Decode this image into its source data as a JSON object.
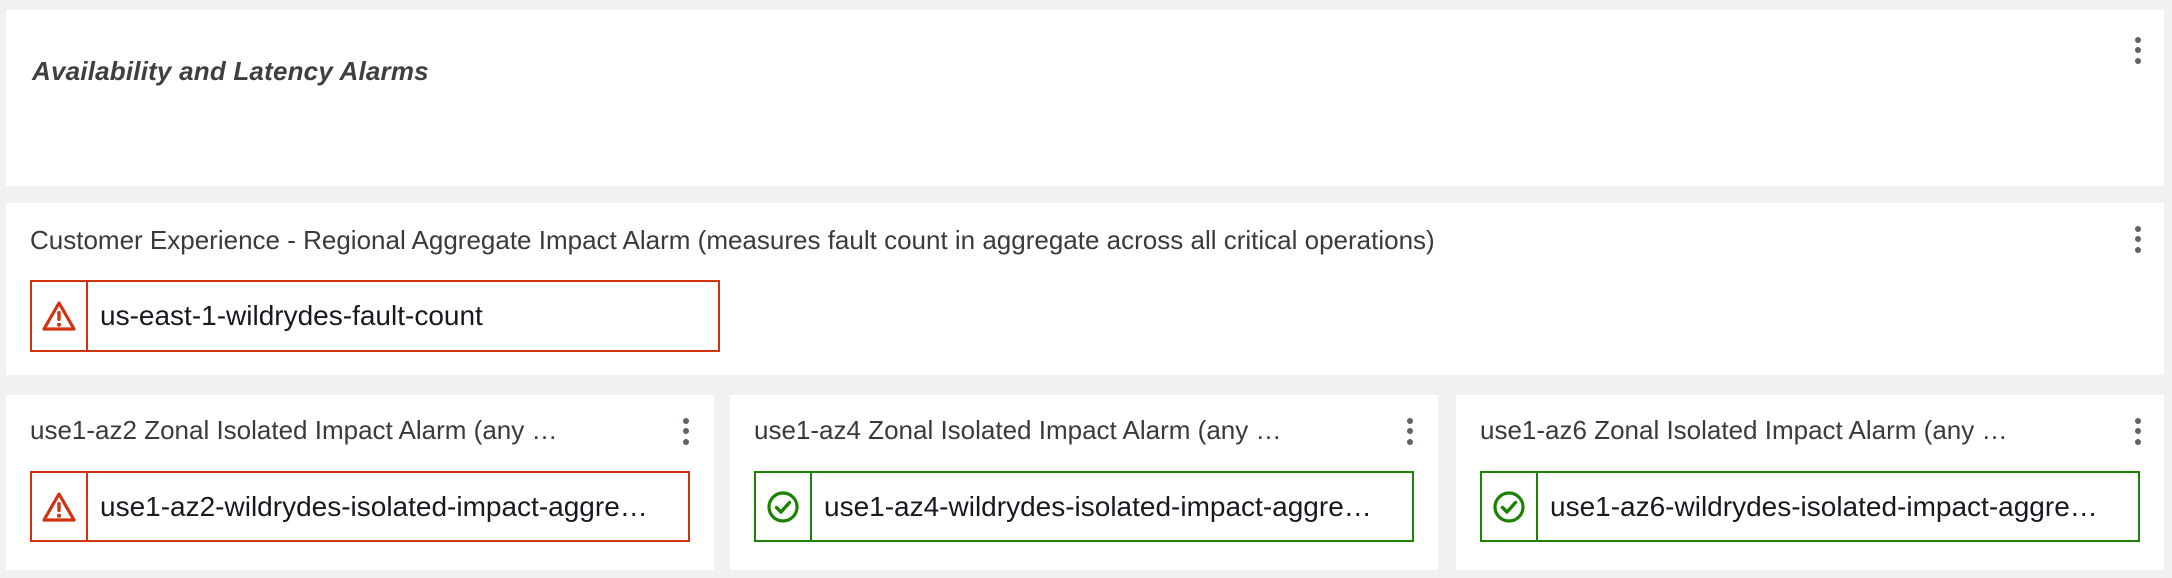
{
  "header_panel": {
    "title": "Availability and Latency Alarms"
  },
  "regional_panel": {
    "title": "Customer Experience - Regional Aggregate Impact Alarm (measures fault count in aggregate across all critical operations)",
    "alarm": {
      "name": "us-east-1-wildrydes-fault-count",
      "state": "alarm",
      "icon": "warning-triangle-icon"
    }
  },
  "zonal_panels": [
    {
      "title": "use1-az2 Zonal Isolated Impact Alarm (any …",
      "alarm": {
        "name": "use1-az2-wildrydes-isolated-impact-aggre…",
        "state": "alarm",
        "icon": "warning-triangle-icon"
      }
    },
    {
      "title": "use1-az4 Zonal Isolated Impact Alarm (any …",
      "alarm": {
        "name": "use1-az4-wildrydes-isolated-impact-aggre…",
        "state": "ok",
        "icon": "check-circle-icon"
      }
    },
    {
      "title": "use1-az6 Zonal Isolated Impact Alarm (any …",
      "alarm": {
        "name": "use1-az6-wildrydes-isolated-impact-aggre…",
        "state": "ok",
        "icon": "check-circle-icon"
      }
    }
  ],
  "colors": {
    "alarm": "#d13212",
    "ok": "#1d8102",
    "background": "#f1f1f1",
    "panel": "#ffffff"
  }
}
